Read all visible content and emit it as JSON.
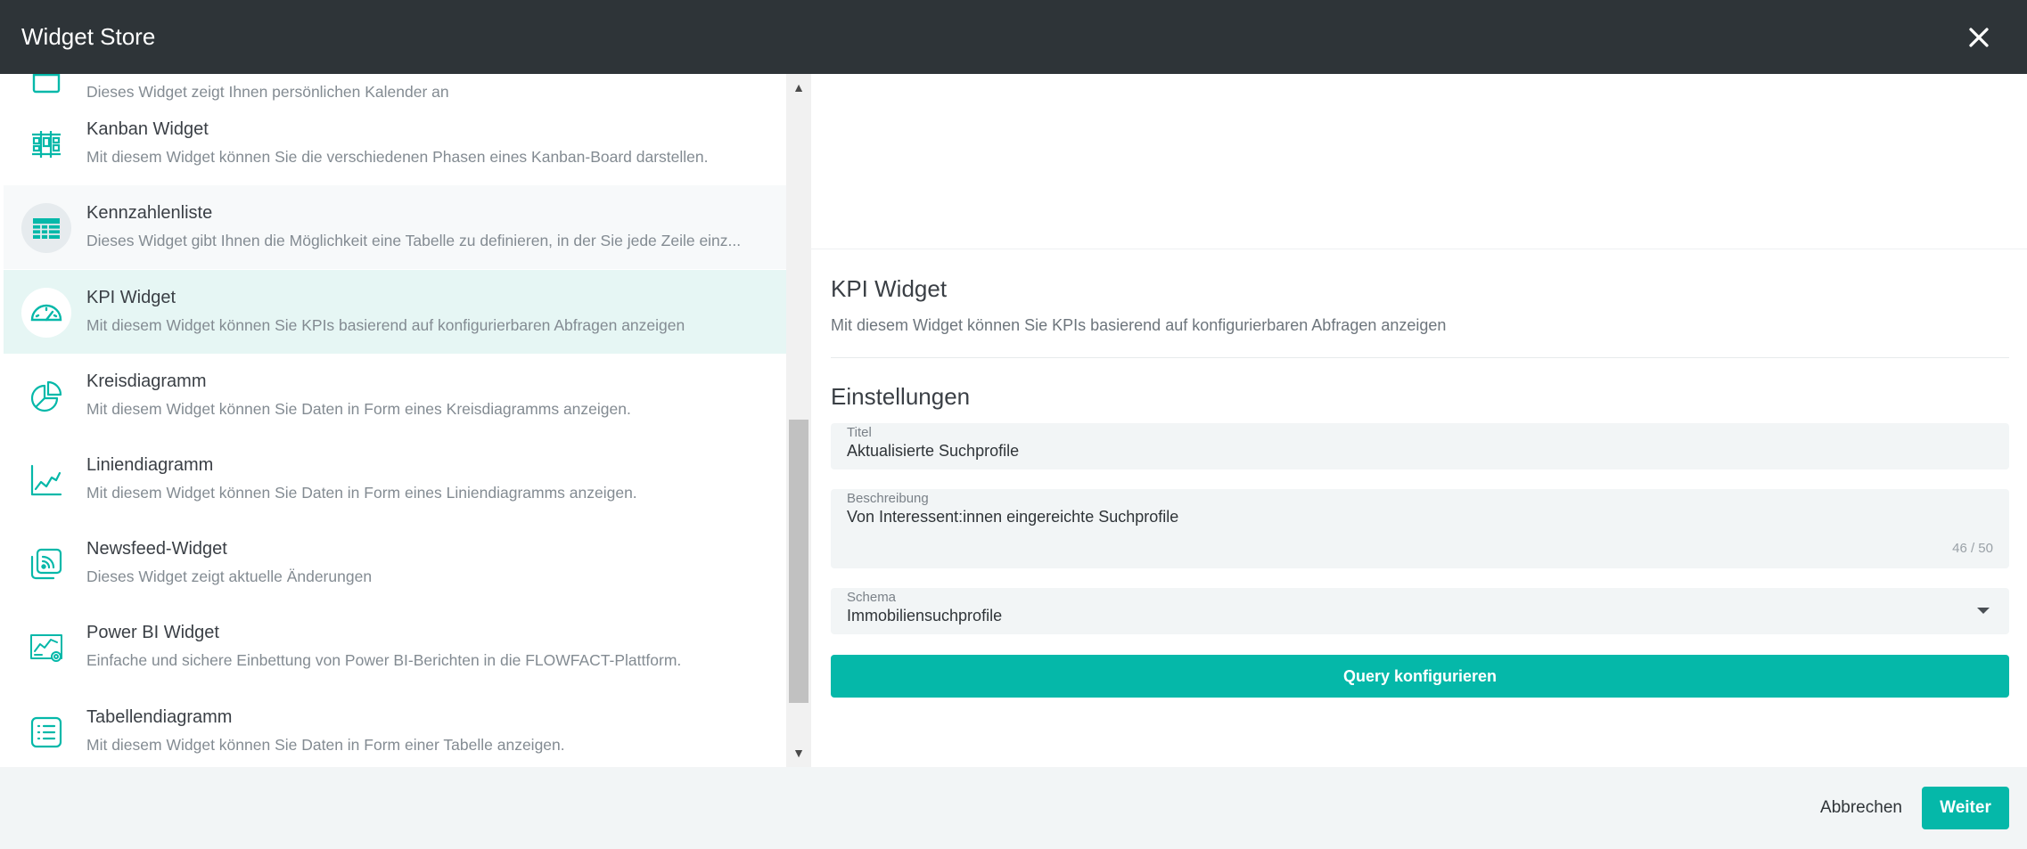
{
  "header": {
    "title": "Widget Store",
    "close_icon": "close-icon"
  },
  "widgets": [
    {
      "name": "",
      "desc": "Dieses Widget zeigt Ihnen persönlichen Kalender an",
      "icon": "calendar-icon",
      "state": "normal"
    },
    {
      "name": "Kanban Widget",
      "desc": "Mit diesem Widget können Sie die verschiedenen Phasen eines Kanban-Board darstellen.",
      "icon": "kanban-icon",
      "state": "normal"
    },
    {
      "name": "Kennzahlenliste",
      "desc": "Dieses Widget gibt Ihnen die Möglichkeit eine Tabelle zu definieren, in der Sie jede Zeile einz...",
      "icon": "table-icon",
      "state": "hover"
    },
    {
      "name": "KPI Widget",
      "desc": "Mit diesem Widget können Sie KPIs basierend auf konfigurierbaren Abfragen anzeigen",
      "icon": "gauge-icon",
      "state": "selected"
    },
    {
      "name": "Kreisdiagramm",
      "desc": "Mit diesem Widget können Sie Daten in Form eines Kreisdiagramms anzeigen.",
      "icon": "pie-chart-icon",
      "state": "normal"
    },
    {
      "name": "Liniendiagramm",
      "desc": "Mit diesem Widget können Sie Daten in Form eines Liniendiagramms anzeigen.",
      "icon": "line-chart-icon",
      "state": "normal"
    },
    {
      "name": "Newsfeed-Widget",
      "desc": "Dieses Widget zeigt aktuelle Änderungen",
      "icon": "rss-feed-icon",
      "state": "normal"
    },
    {
      "name": "Power BI Widget",
      "desc": "Einfache und sichere Einbettung von Power BI-Berichten in die FLOWFACT-Plattform.",
      "icon": "power-bi-icon",
      "state": "normal"
    },
    {
      "name": "Tabellendiagramm",
      "desc": "Mit diesem Widget können Sie Daten in Form einer Tabelle anzeigen.",
      "icon": "list-icon",
      "state": "normal"
    }
  ],
  "detail": {
    "title": "KPI Widget",
    "description": "Mit diesem Widget können Sie KPIs basierend auf konfigurierbaren Abfragen anzeigen",
    "settings_heading": "Einstellungen",
    "title_field": {
      "label": "Titel",
      "value": "Aktualisierte Suchprofile"
    },
    "description_field": {
      "label": "Beschreibung",
      "value": "Von Interessent:innen eingereichte Suchprofile",
      "counter": "46 / 50"
    },
    "schema_field": {
      "label": "Schema",
      "value": "Immobiliensuchprofile"
    },
    "query_button": "Query konfigurieren"
  },
  "footer": {
    "cancel": "Abbrechen",
    "next": "Weiter"
  },
  "colors": {
    "accent": "#05b8a9",
    "header_bg": "#2e3438",
    "selected_bg": "#e6f6f4"
  }
}
